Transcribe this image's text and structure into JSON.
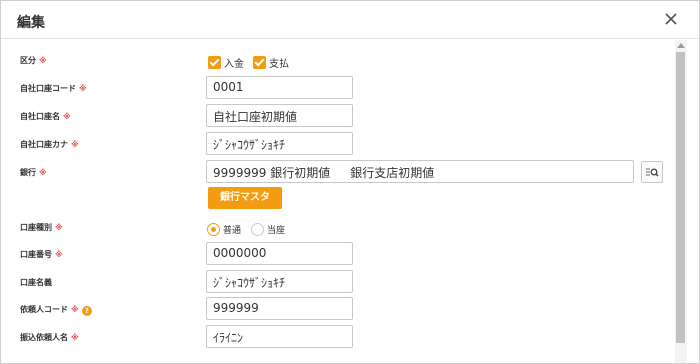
{
  "dialog": {
    "title": "編集"
  },
  "form": {
    "kubun": {
      "label": "区分",
      "required": "※",
      "options": [
        {
          "label": "入金",
          "checked": true
        },
        {
          "label": "支払",
          "checked": true
        }
      ]
    },
    "company_account_code": {
      "label": "自社口座コード",
      "required": "※",
      "value": "0001"
    },
    "company_account_name": {
      "label": "自社口座名",
      "required": "※",
      "value": "自社口座初期値"
    },
    "company_account_kana": {
      "label": "自社口座カナ",
      "required": "※",
      "value": "ｼﾞｼｬｺｳｻﾞｼｮｷﾁ"
    },
    "bank": {
      "label": "銀行",
      "required": "※",
      "code": "9999999",
      "bank_name": "銀行初期値",
      "branch_name": "銀行支店初期値"
    },
    "bank_master_button": "銀行マスタ",
    "account_type": {
      "label": "口座種別",
      "required": "※",
      "options": [
        {
          "label": "普通",
          "selected": true
        },
        {
          "label": "当座",
          "selected": false
        }
      ]
    },
    "account_number": {
      "label": "口座番号",
      "required": "※",
      "value": "0000000"
    },
    "account_holder": {
      "label": "口座名義",
      "value": "ｼﾞｼｬｺｳｻﾞｼｮｷﾁ"
    },
    "client_code": {
      "label": "依頼人コード",
      "required": "※",
      "help": "?",
      "value": "999999"
    },
    "transfer_client_name": {
      "label": "振込依頼人名",
      "required": "※",
      "value": "ｲﾗｲﾆﾝ"
    }
  },
  "colors": {
    "accent": "#f39c12",
    "required": "#e8554e"
  },
  "icons": {
    "close": "close-icon",
    "search": "search-list-icon",
    "help": "help-icon"
  }
}
